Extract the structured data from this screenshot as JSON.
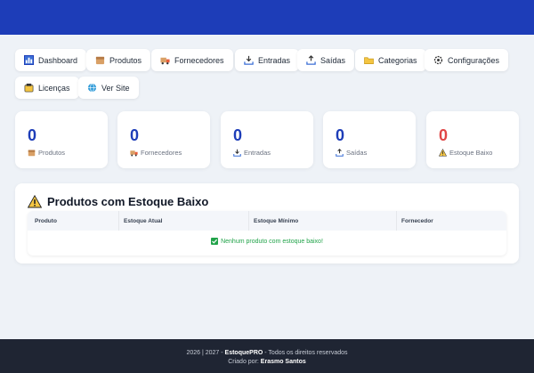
{
  "nav": [
    {
      "label": "Dashboard",
      "icon": "chart-icon"
    },
    {
      "label": "Produtos",
      "icon": "box-icon"
    },
    {
      "label": "Fornecedores",
      "icon": "truck-icon"
    },
    {
      "label": "Entradas",
      "icon": "tray-in-icon"
    },
    {
      "label": "Saídas",
      "icon": "tray-out-icon"
    },
    {
      "label": "Categorias",
      "icon": "folder-icon"
    },
    {
      "label": "Configurações",
      "icon": "gear-icon"
    },
    {
      "label": "Licenças",
      "icon": "license-icon"
    },
    {
      "label": "Ver Site",
      "icon": "globe-icon"
    }
  ],
  "stats": [
    {
      "value": "0",
      "label": "Produtos"
    },
    {
      "value": "0",
      "label": "Fornecedores"
    },
    {
      "value": "0",
      "label": "Entradas"
    },
    {
      "value": "0",
      "label": "Saídas"
    },
    {
      "value": "0",
      "label": "Estoque Baixo"
    }
  ],
  "low_stock": {
    "title": "Produtos com Estoque Baixo",
    "columns": [
      "Produto",
      "Estoque Atual",
      "Estoque Mínimo",
      "Fornecedor"
    ],
    "empty_message": "Nenhum produto com estoque baixo!"
  },
  "footer": {
    "years": "2026 | 2027 - ",
    "brand": "EstoquePRO",
    "rights": " - Todos os direitos reservados",
    "created_by": "Criado por: ",
    "author": "Erasmo Santos"
  },
  "colors": {
    "header": "#1d3db8",
    "accent_blue": "#1d3db8",
    "alert_red": "#e04646",
    "success_green": "#22a34a",
    "footer_bg": "#1f2533"
  }
}
